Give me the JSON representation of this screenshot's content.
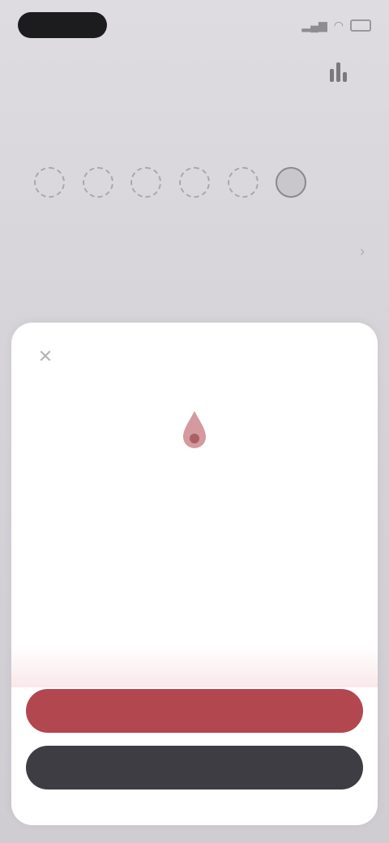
{
  "status_bar": {
    "time": ""
  },
  "header": {
    "title": "",
    "action_icon": "chart-icon"
  },
  "week": {
    "days": [
      {
        "letter": "",
        "today": false
      },
      {
        "letter": "",
        "today": false
      },
      {
        "letter": "",
        "today": false
      },
      {
        "letter": "",
        "today": false
      },
      {
        "letter": "",
        "today": false
      },
      {
        "letter": "",
        "today": true
      },
      {
        "letter": "",
        "today": false
      }
    ],
    "label": ""
  },
  "sheet": {
    "close_icon": "close-icon",
    "hero_icon": "drop-icon",
    "title": "",
    "description": "",
    "primary_button": "",
    "secondary_button": ""
  },
  "colors": {
    "accent": "#b2474f",
    "dark_button": "#3f3d44",
    "background": "#d9d7dc"
  }
}
